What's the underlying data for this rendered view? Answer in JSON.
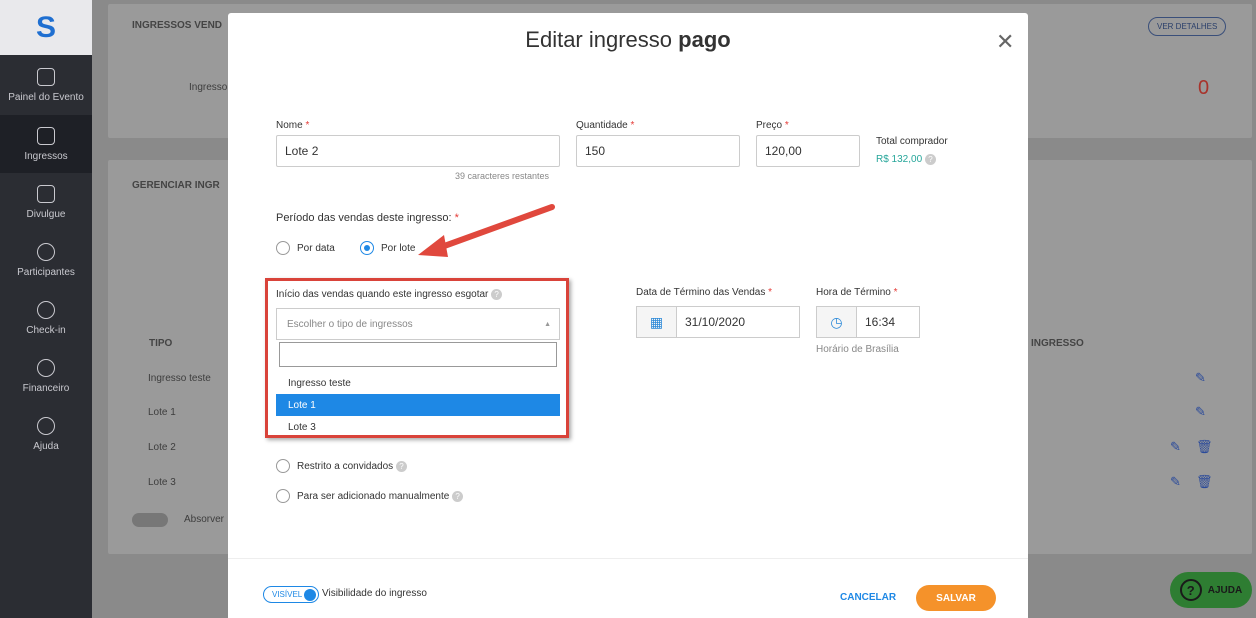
{
  "sidebar": {
    "logo": "S",
    "items": [
      {
        "label": "Painel do Evento",
        "icon": "dashboard-icon"
      },
      {
        "label": "Ingressos",
        "icon": "ticket-icon",
        "active": true
      },
      {
        "label": "Divulgue",
        "icon": "megaphone-icon"
      },
      {
        "label": "Participantes",
        "icon": "users-icon"
      },
      {
        "label": "Check-in",
        "icon": "check-circle-icon"
      },
      {
        "label": "Financeiro",
        "icon": "dollar-icon"
      },
      {
        "label": "Ajuda",
        "icon": "question-icon"
      }
    ]
  },
  "background": {
    "sold_title": "INGRESSOS VEND",
    "details_button": "VER DETALHES",
    "ticket_label": "Ingresso",
    "sold_count": "0",
    "manage_title": "GERENCIAR INGR",
    "col_tipo": "TIPO",
    "col_ingresso": "INGRESSO",
    "rows": [
      "Ingresso teste",
      "Lote 1",
      "Lote 2",
      "Lote 3"
    ],
    "absorb_label": "Absorver",
    "help_button": "AJUDA"
  },
  "modal": {
    "title_prefix": "Editar ingresso",
    "title_bold": "pago",
    "name_label": "Nome",
    "name_value": "Lote 2",
    "name_hint": "39 caracteres restantes",
    "qty_label": "Quantidade",
    "qty_value": "150",
    "price_label": "Preço",
    "price_value": "120,00",
    "total_label": "Total comprador",
    "total_value": "R$ 132,00",
    "period_label": "Período das vendas deste ingresso:",
    "radio_by_date": "Por data",
    "radio_by_lot": "Por lote",
    "start_label": "Início das vendas quando este ingresso esgotar",
    "select_placeholder": "Escolher o tipo de ingressos",
    "options": [
      "Ingresso teste",
      "Lote 1",
      "Lote 3"
    ],
    "selected_option": "Lote 1",
    "end_date_label": "Data de Término das Vendas",
    "end_date_value": "31/10/2020",
    "end_time_label": "Hora de Término",
    "end_time_value": "16:34",
    "timezone": "Horário de Brasília",
    "radio_restricted": "Restrito a convidados",
    "radio_manual": "Para ser adicionado manualmente",
    "visible_toggle": "VISÍVEL",
    "visibility_label": "Visibilidade do ingresso",
    "cancel": "CANCELAR",
    "save": "SALVAR"
  },
  "colors": {
    "accent": "#1e88e5",
    "save": "#f5922a",
    "highlight": "#d9433a",
    "sidebar": "#2b2d33"
  }
}
